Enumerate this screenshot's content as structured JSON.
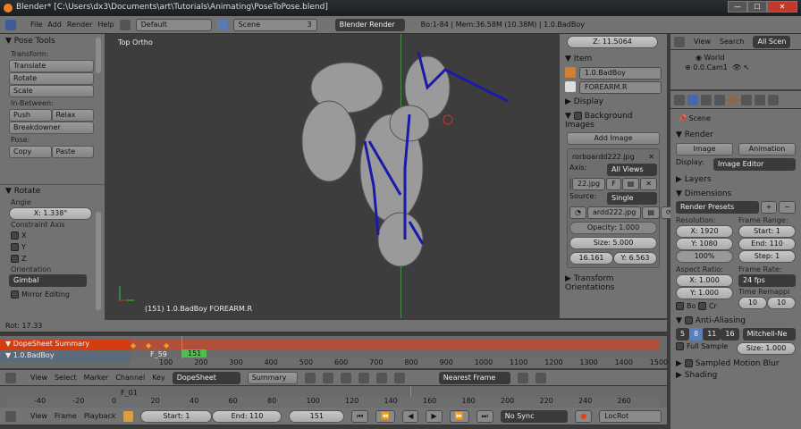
{
  "title": "Blender* [C:\\Users\\dx3\\Documents\\art\\Tutorials\\Animating\\PoseToPose.blend]",
  "window_buttons": [
    "—",
    "☐",
    "✕"
  ],
  "info_header": {
    "menus": [
      "File",
      "Add",
      "Render",
      "Help"
    ],
    "layout": "Default",
    "scene": "Scene",
    "scene_users": "3",
    "engine": "Blender Render",
    "stats": "Bo:1-84 | Mem:36.58M (10.38M) | 1.0.BadBoy"
  },
  "tool_panel": {
    "title": "Pose Tools",
    "transform_label": "Transform:",
    "translate": "Translate",
    "rotate": "Rotate",
    "scale": "Scale",
    "inbetween_label": "In-Between:",
    "push": "Push",
    "relax": "Relax",
    "breakdowner": "Breakdowner",
    "pose_label": "Pose:",
    "copy": "Copy",
    "paste": "Paste"
  },
  "operator_panel": {
    "title": "Rotate",
    "angle_label": "Angle",
    "angle_value": "X: 1.338°",
    "constraint_label": "Constraint Axis",
    "axes": [
      "X",
      "Y",
      "Z"
    ],
    "orientation_label": "Orientation",
    "orientation_value": "Gimbal",
    "mirror_label": "Mirror Editing"
  },
  "viewport": {
    "view_label": "Top Ortho",
    "object_label": "(151) 1.0.BadBoy FOREARM.R",
    "status": "Rot: 17.33"
  },
  "n_panel": {
    "z_value": "Z: 11.5064",
    "item_title": "Item",
    "object_name": "1.0.BadBoy",
    "bone_name": "FOREARM.R",
    "display": "Display",
    "bg_images": "Background Images",
    "add_image": "Add Image",
    "image_name": "rorboardd222.jpg",
    "axis_label": "Axis:",
    "axis_value": "All Views",
    "image_file": "22.jpg",
    "f_label": "F",
    "source_label": "Source:",
    "source_value": "Single Imag",
    "source_file": "ardd222.jpg",
    "opacity": "Opacity: 1.000",
    "size": "Size: 5.000",
    "x_offset": "16.161",
    "y_offset": "Y: 6.563",
    "transform_orientations": "Transform Orientations"
  },
  "outliner": {
    "menus": [
      "View",
      "Search"
    ],
    "filter": "All Scen",
    "items": [
      "World",
      "0.0.Cam1"
    ]
  },
  "properties": {
    "context": "Scene",
    "render_title": "Render",
    "image_btn": "Image",
    "animation_btn": "Animation",
    "display_label": "Display:",
    "display_value": "Image Editor",
    "layers": "Layers",
    "dimensions": "Dimensions",
    "presets": "Render Presets",
    "resolution_label": "Resolution:",
    "res_x": "X: 1920",
    "res_y": "Y: 1080",
    "res_pct": "100%",
    "frame_range_label": "Frame Range:",
    "start": "Start: 1",
    "end": "End: 110",
    "step": "Step: 1",
    "aspect_label": "Aspect Ratio:",
    "asp_x": "X: 1.000",
    "asp_y": "Y: 1.000",
    "framerate_label": "Frame Rate:",
    "framerate": "24 fps",
    "remap_label": "Time Remappi",
    "remap_old": "10",
    "remap_new": "10",
    "border": "Bo",
    "crop": "Cr",
    "aa_title": "Anti-Aliasing",
    "aa_samples": [
      "5",
      "8",
      "11",
      "16"
    ],
    "aa_filter": "Mitchell-Ne",
    "full_sample": "Full Sample",
    "aa_size": "Size: 1.000",
    "motion_blur": "Sampled Motion Blur",
    "shading": "Shading"
  },
  "dopesheet": {
    "channels": [
      "DopeSheet Summary",
      "1.0.BadBoy"
    ],
    "marker": "F_59",
    "current_frame": "151",
    "ruler": [
      "100",
      "200",
      "300",
      "400",
      "500",
      "600",
      "700",
      "800",
      "900",
      "1000",
      "1100",
      "1200",
      "1300",
      "1400",
      "1500"
    ],
    "menus": [
      "View",
      "Select",
      "Marker",
      "Channel",
      "Key"
    ],
    "mode": "DopeSheet",
    "summary": "Summary",
    "snap": "Nearest Frame"
  },
  "timeline": {
    "marker": "F_01",
    "ruler": [
      "-40",
      "-20",
      "0",
      "20",
      "40",
      "60",
      "80",
      "100",
      "120",
      "140",
      "160",
      "180",
      "200",
      "220",
      "240",
      "260"
    ],
    "menus": [
      "View",
      "Frame",
      "Playback"
    ],
    "start": "Start: 1",
    "end": "End: 110",
    "current": "151",
    "sync": "No Sync",
    "keying_set": "LocRot"
  },
  "colors": {
    "summary_channel": "#d43c12",
    "active_frame": "#4cc04c",
    "key": "#f0a020",
    "bone": "#1a1aa8"
  }
}
